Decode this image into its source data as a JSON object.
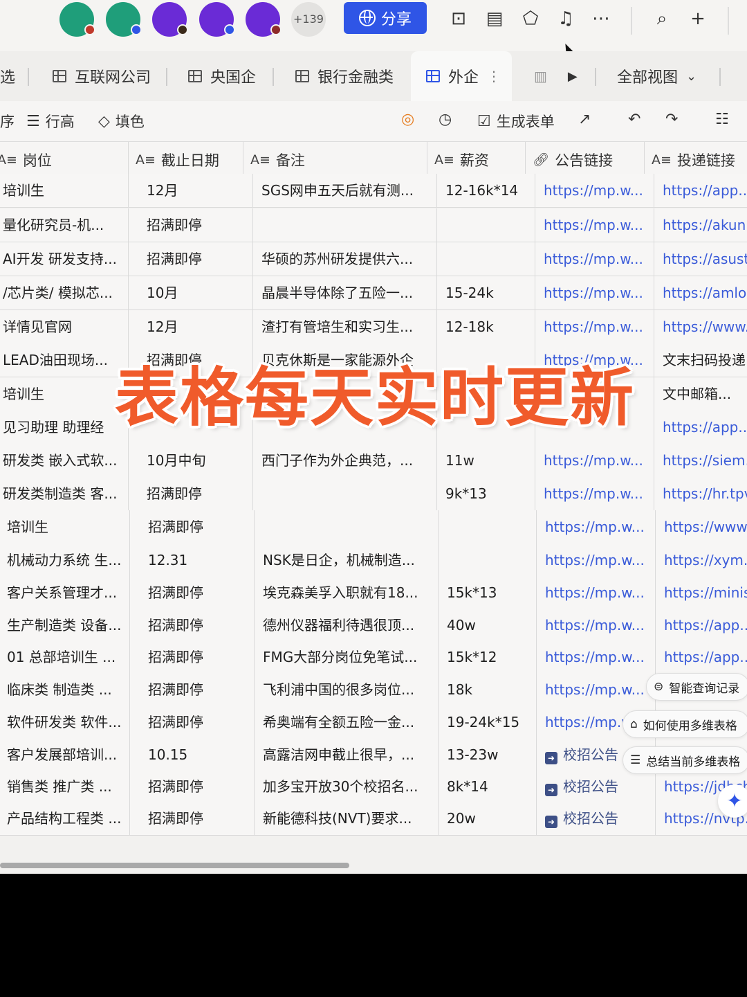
{
  "topbar": {
    "more_collaborators": "+139",
    "share_label": "分享",
    "avatar_colors": [
      "#1f9e7a",
      "#1f9e7a",
      "#6a2bd6",
      "#6a2bd6",
      "#6a2bd6"
    ],
    "icons": [
      "robot-icon",
      "doc-scan-icon",
      "plugin-icon",
      "bell-icon",
      "more-icon",
      "search-icon",
      "plus-icon"
    ]
  },
  "tabs": {
    "partial": "选",
    "items": [
      "互联网公司",
      "央国企",
      "银行金融类",
      "外企"
    ],
    "active": "外企",
    "all_views": "全部视图"
  },
  "toolbar": {
    "partial": "序",
    "row_height": "行高",
    "fill_color": "填色",
    "generate_form": "生成表单"
  },
  "table": {
    "headers": [
      {
        "type": "A≡",
        "label": "岗位"
      },
      {
        "type": "A≡",
        "label": "截止日期"
      },
      {
        "type": "A≡",
        "label": "备注"
      },
      {
        "type": "A≡",
        "label": "薪资"
      },
      {
        "type": "link",
        "label": "公告链接"
      },
      {
        "type": "A≡",
        "label": "投递链接"
      }
    ],
    "rows": [
      [
        "培训生",
        "12月",
        "SGS网申五天后就有测...",
        "12-16k*14",
        "https://mp.w...",
        "https://app...."
      ],
      [
        "量化研究员-机...",
        "招满即停",
        "",
        "",
        "https://mp.w...",
        "https://akun..."
      ],
      [
        "AI开发 研发支持...",
        "招满即停",
        "华硕的苏州研发提供六...",
        "",
        "https://mp.w...",
        "https://asust..."
      ],
      [
        "/芯片类/ 模拟芯...",
        "10月",
        "晶晨半导体除了五险一...",
        "15-24k",
        "https://mp.w...",
        "https://amlo..."
      ],
      [
        "详情见官网",
        "12月",
        "渣打有管培生和实习生...",
        "12-18k",
        "https://mp.w...",
        "https://www...."
      ],
      [
        "LEAD油田现场...",
        "招满即停",
        "贝克休斯是一家能源外企",
        "",
        "https://mp.w...",
        "文末扫码投递"
      ],
      [
        "培训生",
        "",
        "",
        "",
        "",
        "文中邮箱..."
      ],
      [
        "见习助理 助理经",
        "",
        "",
        "",
        "",
        "https://app...."
      ],
      [
        "研发类 嵌入式软...",
        "10月中旬",
        "西门子作为外企典范，...",
        "11w",
        "https://mp.w...",
        "https://sieme..."
      ],
      [
        "研发类制造类 客...",
        "招满即停",
        "",
        "9k*13",
        "https://mp.w...",
        "https://hr.tpv..."
      ],
      [
        "培训生",
        "招满即停",
        "",
        "",
        "https://mp.w...",
        "https://www...."
      ],
      [
        "机械动力系统 生...",
        "12.31",
        "NSK是日企，机械制造...",
        "",
        "https://mp.w...",
        "https://xym...."
      ],
      [
        "客户关系管理才...",
        "招满即停",
        "埃克森美孚入职就有18...",
        "15k*13",
        "https://mp.w...",
        "https://minisi..."
      ],
      [
        "生产制造类 设备...",
        "招满即停",
        "德州仪器福利待遇很顶...",
        "40w",
        "https://mp.w...",
        "https://app...."
      ],
      [
        "01 总部培训生 ...",
        "招满即停",
        "FMG大部分岗位免笔试...",
        "15k*12",
        "https://mp.w...",
        "https://app...."
      ],
      [
        "临床类 制造类 ...",
        "招满即停",
        "飞利浦中国的很多岗位...",
        "18k",
        "https://mp.w...",
        ""
      ],
      [
        "软件研发类 软件...",
        "招满即停",
        "希奥端有全额五险一金...",
        "19-24k*15",
        "https://mp.w...",
        ""
      ],
      [
        "客户发展部培训...",
        "10.15",
        "高露洁网申截止很早，...",
        "13-23w",
        "校招公告",
        ""
      ],
      [
        "销售类 推广类 ...",
        "招满即停",
        "加多宝开放30个校招名...",
        "8k*14",
        "校招公告",
        "https://jdbch..."
      ],
      [
        "产品结构工程类 ...",
        "招满即停",
        "新能德科技(NVT)要求...",
        "20w",
        "校招公告",
        "https://nvtp..."
      ]
    ]
  },
  "overlay_banner": "表格每天实时更新",
  "assistant": {
    "smart_query": "智能查询记录",
    "how_to_use": "如何使用多维表格",
    "summarize": "总结当前多维表格"
  },
  "colors": {
    "accent": "#2f55e6",
    "banner": "#f05b2b",
    "link": "#3a5bd9"
  }
}
